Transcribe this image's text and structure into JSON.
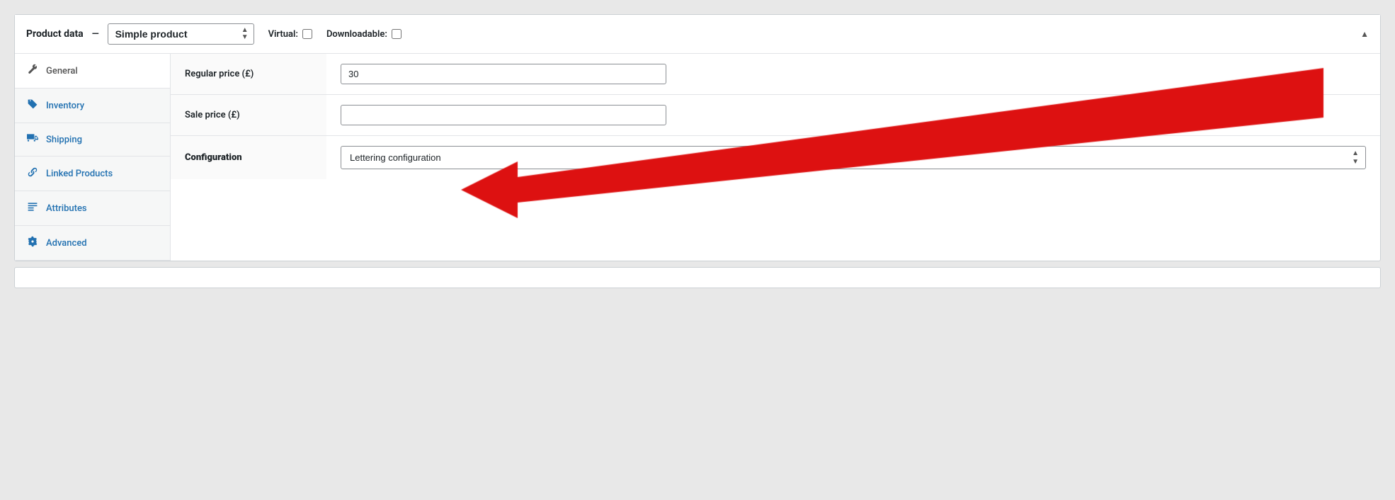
{
  "header": {
    "product_data_label": "Product data",
    "dash": "—",
    "product_type": "Simple product",
    "virtual_label": "Virtual:",
    "downloadable_label": "Downloadable:",
    "collapse_icon": "▲"
  },
  "sidebar": {
    "items": [
      {
        "id": "general",
        "label": "General",
        "icon": "⚙"
      },
      {
        "id": "inventory",
        "label": "Inventory",
        "icon": "🏷"
      },
      {
        "id": "shipping",
        "label": "Shipping",
        "icon": "🚚"
      },
      {
        "id": "linked-products",
        "label": "Linked Products",
        "icon": "🔗"
      },
      {
        "id": "attributes",
        "label": "Attributes",
        "icon": "☰"
      },
      {
        "id": "advanced",
        "label": "Advanced",
        "icon": "⚙"
      }
    ]
  },
  "fields": [
    {
      "id": "regular-price",
      "label": "Regular price (£)",
      "type": "text",
      "value": "30",
      "placeholder": ""
    },
    {
      "id": "sale-price",
      "label": "Sale price (£)",
      "type": "text",
      "value": "",
      "placeholder": ""
    },
    {
      "id": "configuration",
      "label": "Configuration",
      "type": "select",
      "value": "Lettering configuration",
      "options": [
        "Lettering configuration"
      ]
    }
  ],
  "icons": {
    "general": "⚙",
    "inventory": "🏷",
    "shipping": "🚛",
    "linked_products": "🔗",
    "attributes": "▦",
    "advanced": "⚙",
    "arrow_up": "▲",
    "arrow_ud": "⬍"
  }
}
